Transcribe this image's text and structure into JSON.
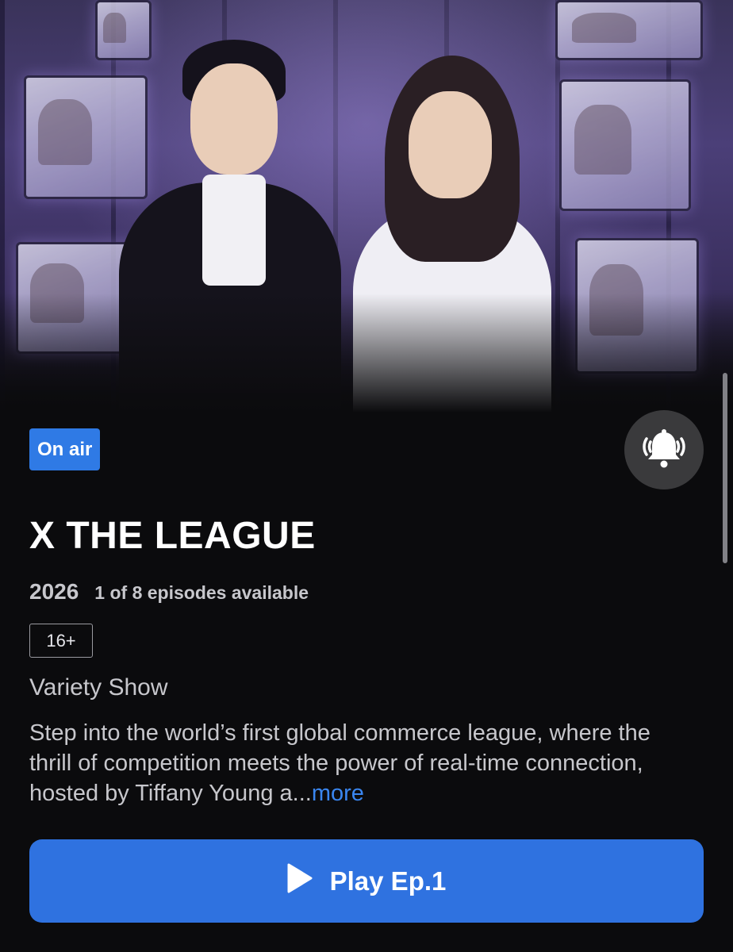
{
  "badge": {
    "label": "On air"
  },
  "title": "X THE LEAGUE",
  "meta": {
    "year": "2026",
    "episodes": "1 of 8 episodes available"
  },
  "rating": "16+",
  "genre": "Variety Show",
  "description": {
    "text": "Step into the world’s first global commerce league, where the thrill of competition meets the power of real-time connection, hosted by Tiffany Young a...",
    "more_label": "more"
  },
  "play_button": {
    "label": "Play Ep.1"
  },
  "icons": {
    "notify": "bell-ringing-icon",
    "play": "play-icon"
  },
  "colors": {
    "accent": "#2f72e0",
    "more_link": "#3a86f0",
    "background": "#0b0b0d"
  }
}
